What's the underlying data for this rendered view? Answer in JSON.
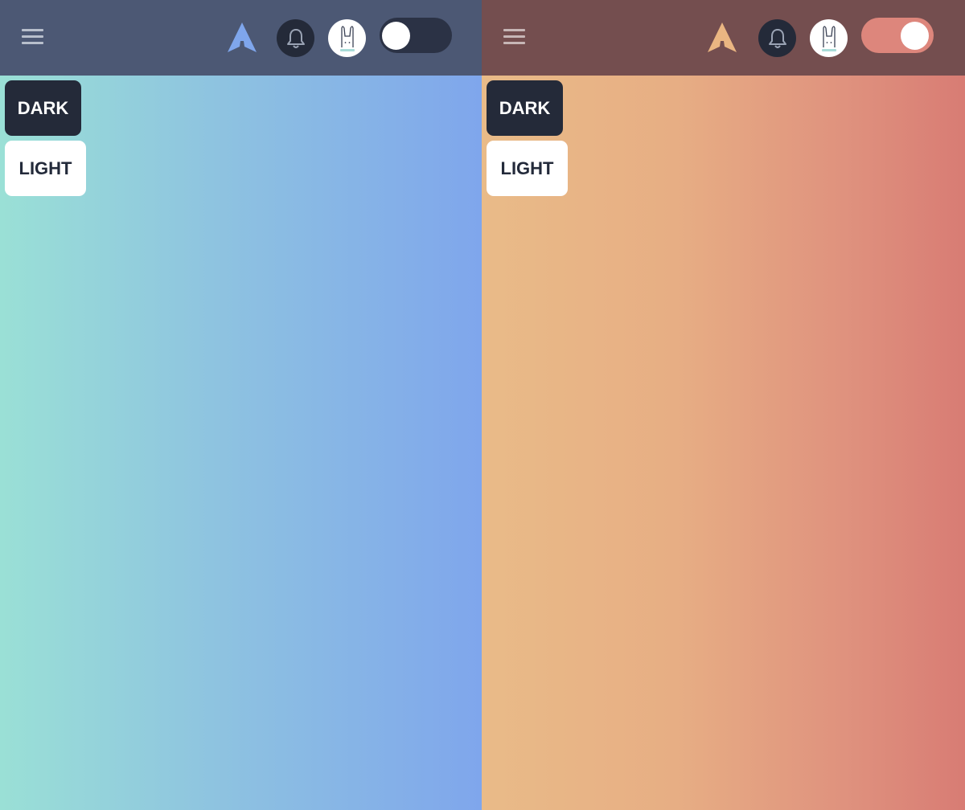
{
  "panels": [
    {
      "theme": "blue",
      "colors": {
        "header": "#4c5874",
        "accent": "#7fa6ec",
        "gradient_start": "#9ae0d6",
        "gradient_end": "#7fa6ec"
      },
      "toggle_state": "off",
      "icons": {
        "menu": "hamburger-menu-icon",
        "logo": "logo-arrow-icon",
        "notifications": "bell-icon",
        "avatar": "bunny-avatar-icon"
      },
      "buttons": {
        "dark": "DARK",
        "light": "LIGHT"
      }
    },
    {
      "theme": "orange",
      "colors": {
        "header": "#744e4f",
        "accent": "#eab682",
        "gradient_start": "#e9bb88",
        "gradient_end": "#d87c74"
      },
      "toggle_state": "on",
      "icons": {
        "menu": "hamburger-menu-icon",
        "logo": "logo-arrow-icon",
        "notifications": "bell-icon",
        "avatar": "bunny-avatar-icon"
      },
      "buttons": {
        "dark": "DARK",
        "light": "LIGHT"
      }
    }
  ]
}
